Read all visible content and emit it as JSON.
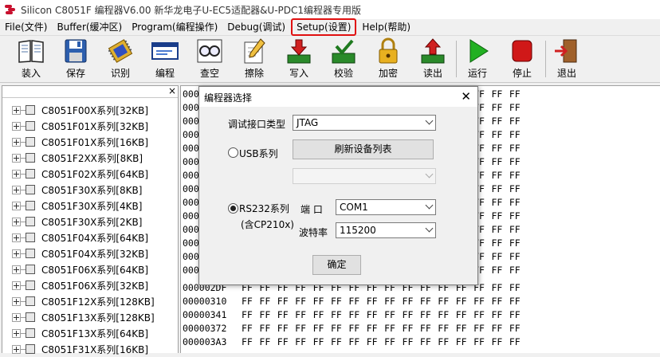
{
  "window": {
    "title": "Silicon C8051F 编程器V6.00  新华龙电子U-EC5适配器&U-PDC1编程器专用版"
  },
  "menu": [
    {
      "label": "File(文件)"
    },
    {
      "label": "Buffer(缓冲区)"
    },
    {
      "label": "Program(编程操作)"
    },
    {
      "label": "Debug(调试)"
    },
    {
      "label": "Setup(设置)",
      "highlighted": true
    },
    {
      "label": "Help(帮助)"
    }
  ],
  "toolbar": {
    "load": "装入",
    "save": "保存",
    "identify": "识别",
    "program": "编程",
    "blank_check": "查空",
    "erase": "擦除",
    "write": "写入",
    "verify": "校验",
    "encrypt": "加密",
    "read": "读出",
    "run": "运行",
    "stop": "停止",
    "exit": "退出"
  },
  "tree": {
    "close": "×",
    "items": [
      "C8051F00X系列[32KB]",
      "C8051F01X系列[32KB]",
      "C8051F01X系列[16KB]",
      "C8051F2XX系列[8KB]",
      "C8051F02X系列[64KB]",
      "C8051F30X系列[8KB]",
      "C8051F30X系列[4KB]",
      "C8051F30X系列[2KB]",
      "C8051F04X系列[64KB]",
      "C8051F04X系列[32KB]",
      "C8051F06X系列[64KB]",
      "C8051F06X系列[32KB]",
      "C8051F12X系列[128KB]",
      "C8051F13X系列[128KB]",
      "C8051F13X系列[64KB]",
      "C8051F31X系列[16KB]"
    ]
  },
  "hex": {
    "left_rows": [
      "000",
      "000",
      "000",
      "000",
      "000",
      "000",
      "000",
      "000",
      "000",
      "000",
      "000",
      "000",
      "000",
      "000"
    ],
    "right_cells": "FF",
    "rows": [
      {
        "addr": "000002DF",
        "byte": "FF"
      },
      {
        "addr": "00000310",
        "byte": "FF"
      },
      {
        "addr": "00000341",
        "byte": "FF"
      },
      {
        "addr": "00000372",
        "byte": "FF"
      },
      {
        "addr": "000003A3",
        "byte": "FF"
      }
    ]
  },
  "dialog": {
    "title": "编程器选择",
    "close": "✕",
    "interface_label": "调试接口类型",
    "interface_value": "JTAG",
    "usb_label": "USB系列",
    "refresh_button": "刷新设备列表",
    "usb_device_value": "",
    "rs232_label": "RS232系列",
    "rs232_sub": "(含CP210x)",
    "port_label": "端  口",
    "port_value": "COM1",
    "baud_label": "波特率",
    "baud_value": "115200",
    "ok_button": "确定",
    "selected": "rs232"
  },
  "colors": {
    "highlight_outline": "#e01010"
  }
}
